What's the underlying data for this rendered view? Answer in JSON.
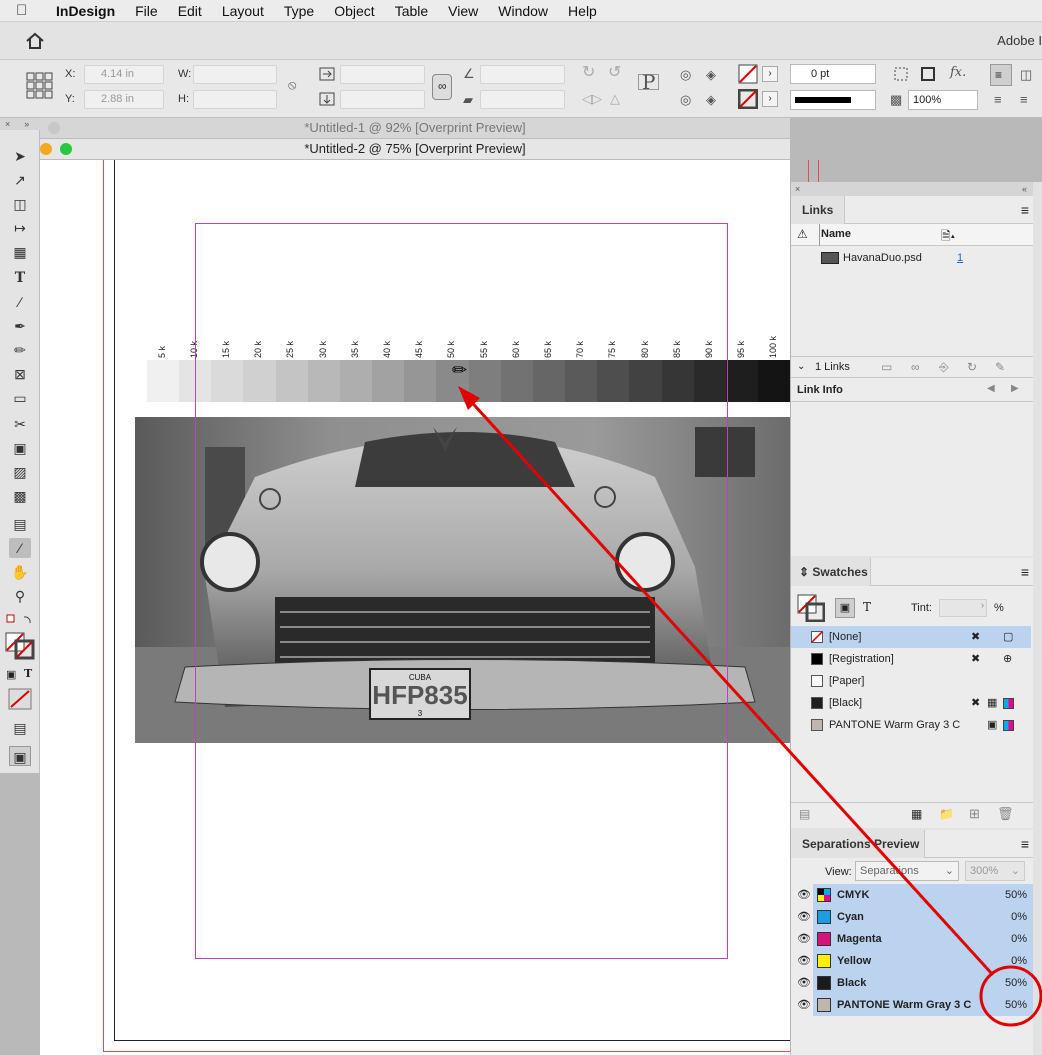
{
  "menu": {
    "apple": "",
    "app": "InDesign",
    "items": [
      "File",
      "Edit",
      "Layout",
      "Type",
      "Object",
      "Table",
      "View",
      "Window",
      "Help"
    ]
  },
  "appbar": {
    "right_label": "Adobe I"
  },
  "control": {
    "x_label": "X:",
    "x_value": "4.14 in",
    "y_label": "Y:",
    "y_value": "2.88 in",
    "w_label": "W:",
    "h_label": "H:",
    "stroke_weight": "0 pt",
    "opacity": "100%",
    "fx": "fx."
  },
  "tabs": {
    "doc1": "*Untitled-1 @ 92% [Overprint Preview]",
    "doc2": "*Untitled-2 @ 75% [Overprint Preview]"
  },
  "ruler_labels": [
    "5 k",
    "10 k",
    "15 k",
    "20 k",
    "25 k",
    "30 k",
    "35 k",
    "40 k",
    "45 k",
    "50 k",
    "55 k",
    "60 k",
    "65 k",
    "70 k",
    "75 k",
    "80 k",
    "85 k",
    "90 k",
    "95 k",
    "100 k"
  ],
  "plate": {
    "top": "CUBA",
    "number": "HFP835",
    "bottom": "3"
  },
  "links": {
    "title": "Links",
    "col_name": "Name",
    "file": "HavanaDuo.psd",
    "page": "1",
    "count": "1 Links",
    "info": "Link Info"
  },
  "swatches": {
    "title": "Swatches",
    "tint_label": "Tint:",
    "tint_unit": "%",
    "items": [
      {
        "name": "[None]",
        "color": "#ffffff"
      },
      {
        "name": "[Registration]",
        "color": "#000000"
      },
      {
        "name": "[Paper]",
        "color": "#ffffff"
      },
      {
        "name": "[Black]",
        "color": "#1e1e1e"
      },
      {
        "name": "PANTONE Warm Gray 3 C",
        "color": "#bfb6b0"
      }
    ]
  },
  "separations": {
    "title": "Separations Preview",
    "view_label": "View:",
    "view_value": "Separations",
    "zoom": "300%",
    "items": [
      {
        "name": "CMYK",
        "value": "50%",
        "color": "#555555"
      },
      {
        "name": "Cyan",
        "value": "0%",
        "color": "#1a9ee0"
      },
      {
        "name": "Magenta",
        "value": "0%",
        "color": "#d6127d"
      },
      {
        "name": "Yellow",
        "value": "0%",
        "color": "#ffef00"
      },
      {
        "name": "Black",
        "value": "50%",
        "color": "#1a1a1a"
      },
      {
        "name": "PANTONE Warm Gray 3 C",
        "value": "50%",
        "color": "#bfb6b0"
      }
    ]
  },
  "colors": {
    "accent": "#e00000",
    "selection": "#bcd3ef",
    "frame": "#c040c0"
  }
}
